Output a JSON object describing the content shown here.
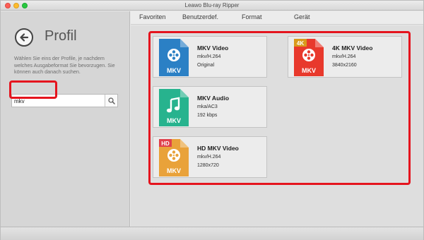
{
  "window": {
    "title": "Leawo Blu-ray Ripper"
  },
  "sidebar": {
    "title": "Profil",
    "description": "Wählen Sie eins der Profile, je nachdem welches Ausgabeformat Sie bevorzugen. Sie können auch danach suchen.",
    "search": {
      "value": "mkv",
      "placeholder": ""
    }
  },
  "tabs": [
    {
      "label": "Favoriten"
    },
    {
      "label": "Benutzerdef."
    },
    {
      "label": "Format"
    },
    {
      "label": "Gerät"
    }
  ],
  "profiles": [
    {
      "name": "MKV Video",
      "codec": "mkv/H.264",
      "extra": "Original",
      "icon_label": "MKV",
      "badge": "",
      "icon_color": "#2b80c5",
      "icon_type": "film"
    },
    {
      "name": "4K MKV Video",
      "codec": "mkv/H.264",
      "extra": "3840x2160",
      "icon_label": "MKV",
      "badge": "4K",
      "icon_color": "#e8392c",
      "icon_type": "film"
    },
    {
      "name": "MKV Audio",
      "codec": "mka/AC3",
      "extra": "192 kbps",
      "icon_label": "MKV",
      "badge": "",
      "icon_color": "#27b38e",
      "icon_type": "music"
    },
    {
      "name": "HD MKV Video",
      "codec": "mkv/H.264",
      "extra": "1280x720",
      "icon_label": "MKV",
      "badge": "HD",
      "icon_color": "#e9a23a",
      "icon_type": "film"
    }
  ],
  "colors": {
    "highlight": "#e5141e",
    "badge_4k": "#d99a1c",
    "badge_hd": "#e0404b"
  }
}
